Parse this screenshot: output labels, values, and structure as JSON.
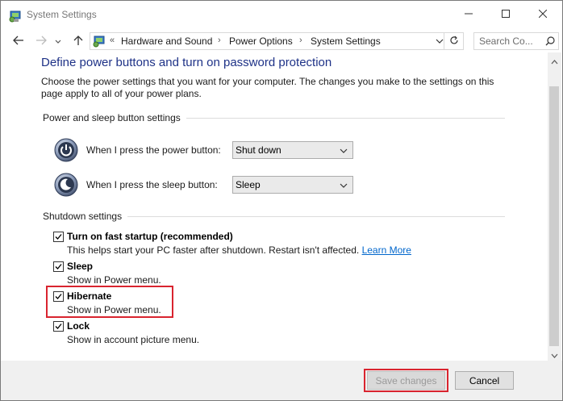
{
  "window": {
    "title": "System Settings",
    "icons": {
      "app": "control-panel-icon",
      "minimize": "minimize-icon",
      "maximize": "maximize-icon",
      "close": "close-icon"
    }
  },
  "navigation": {
    "icons": {
      "back": "back-arrow-icon",
      "forward": "forward-arrow-icon",
      "recent": "chevron-down-icon",
      "up": "up-arrow-icon",
      "refresh": "refresh-icon",
      "search": "search-icon"
    },
    "overflow": "«",
    "breadcrumb": [
      "Hardware and Sound",
      "Power Options",
      "System Settings"
    ],
    "separator": "›",
    "search_placeholder": "Search Co..."
  },
  "page": {
    "heading": "Define power buttons and turn on password protection",
    "description": "Choose the power settings that you want for your computer. The changes you make to the settings on this page apply to all of your power plans.",
    "power_sleep": {
      "group_title": "Power and sleep button settings",
      "power_button": {
        "label": "When I press the power button:",
        "value": "Shut down",
        "icon": "power-button-icon"
      },
      "sleep_button": {
        "label": "When I press the sleep button:",
        "value": "Sleep",
        "icon": "sleep-button-icon"
      }
    },
    "shutdown": {
      "group_title": "Shutdown settings",
      "options": [
        {
          "label": "Turn on fast startup (recommended)",
          "description": "This helps start your PC faster after shutdown. Restart isn't affected.",
          "link": "Learn More",
          "checked": true
        },
        {
          "label": "Sleep",
          "description": "Show in Power menu.",
          "checked": true
        },
        {
          "label": "Hibernate",
          "description": "Show in Power menu.",
          "checked": true,
          "highlighted": true
        },
        {
          "label": "Lock",
          "description": "Show in account picture menu.",
          "checked": true
        }
      ]
    }
  },
  "footer": {
    "save_label": "Save changes",
    "cancel_label": "Cancel"
  },
  "colors": {
    "heading": "#1e3287",
    "link": "#0066cc",
    "highlight": "#d9242f"
  }
}
